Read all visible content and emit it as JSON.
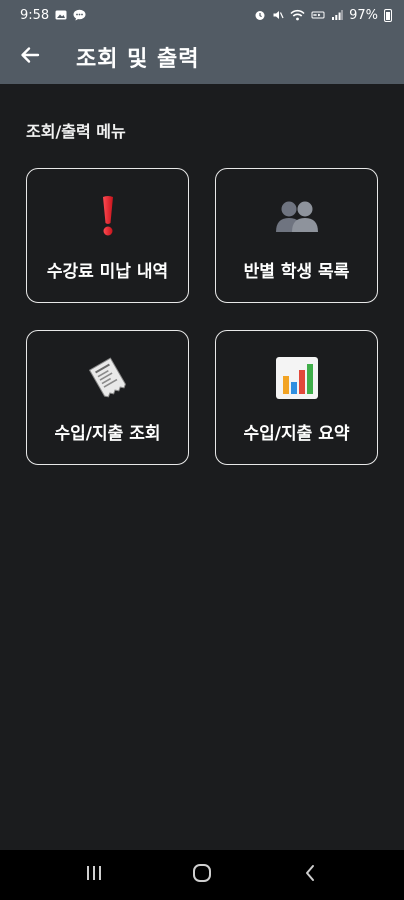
{
  "status_bar": {
    "time": "9:58",
    "battery": "97%"
  },
  "app_bar": {
    "title": "조회 및 출력"
  },
  "section": {
    "label": "조회/출력 메뉴"
  },
  "tiles": [
    {
      "label": "수강료 미납 내역",
      "icon": "exclamation-icon"
    },
    {
      "label": "반별 학생 목록",
      "icon": "people-icon"
    },
    {
      "label": "수입/지출 조회",
      "icon": "receipt-icon"
    },
    {
      "label": "수입/지출 요약",
      "icon": "bar-chart-icon"
    }
  ],
  "colors": {
    "background": "#1b1c1e",
    "app_bar": "#525b64",
    "tile_border": "#e8e8e8",
    "alert_red": "#e0202a"
  }
}
